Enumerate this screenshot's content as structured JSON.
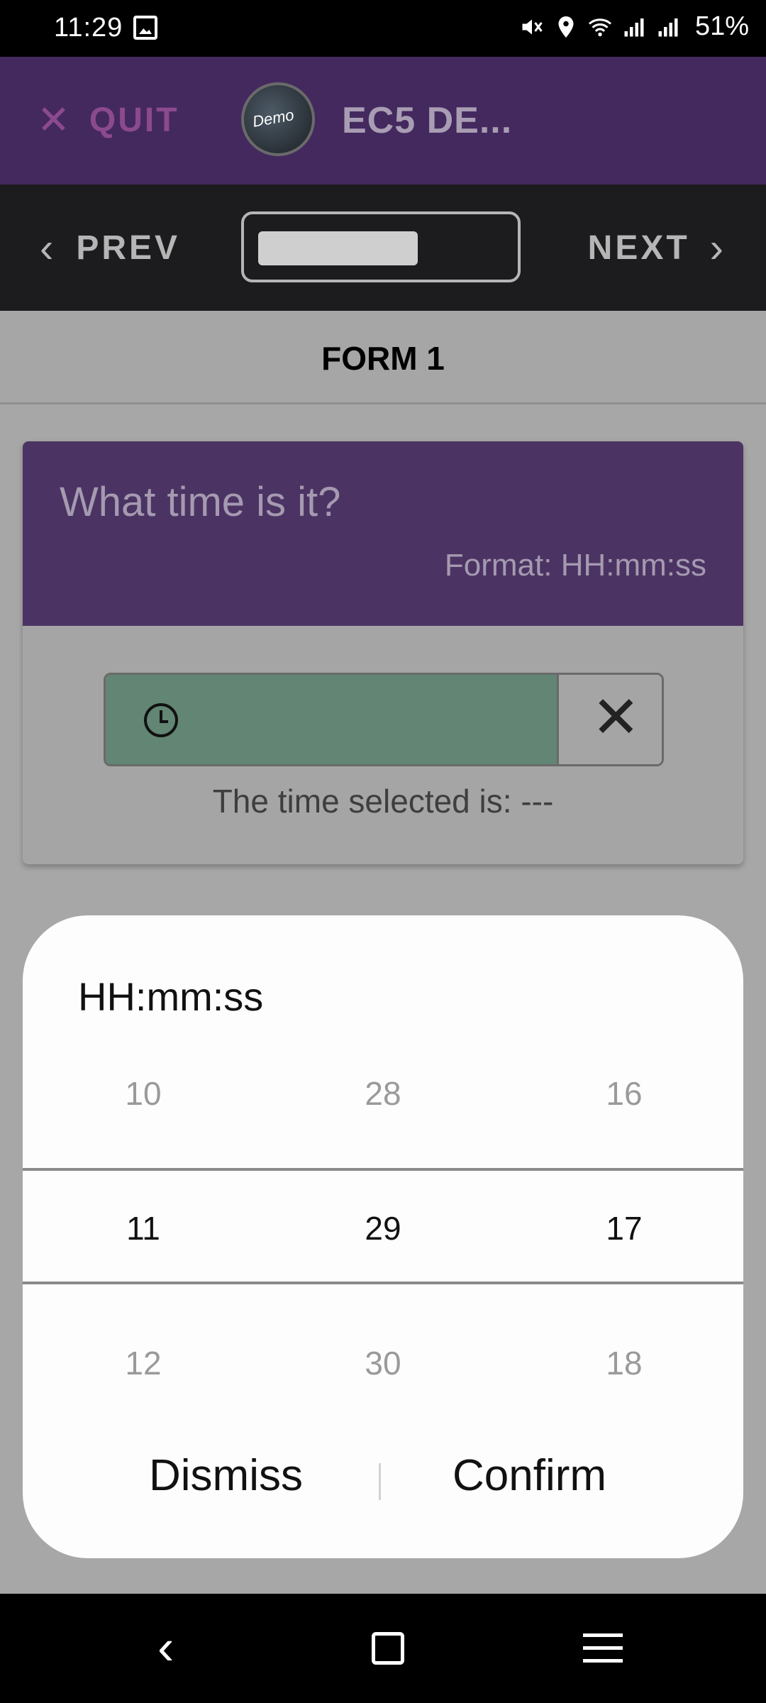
{
  "status_bar": {
    "time": "11:29",
    "battery": "51%",
    "icons": [
      "gallery-icon",
      "mute-icon",
      "location-icon",
      "wifi-icon",
      "signal-icon",
      "signal-r-icon"
    ]
  },
  "app_bar": {
    "quit_label": "QUIT",
    "quit_icon": "close-icon",
    "avatar_text": "Demo",
    "title": "EC5 DE..."
  },
  "nav": {
    "prev_label": "PREV",
    "next_label": "NEXT",
    "progress": 0.65
  },
  "form": {
    "title": "FORM 1"
  },
  "question": {
    "text": "What time is it?",
    "format": "Format: HH:mm:ss",
    "selected_text": "The time selected is: ---",
    "input_color": "#628574",
    "header_color": "#4b3463"
  },
  "picker": {
    "title": "HH:mm:ss",
    "columns": [
      {
        "above": "10",
        "selected": "11",
        "below": "12"
      },
      {
        "above": "28",
        "selected": "29",
        "below": "30"
      },
      {
        "above": "16",
        "selected": "17",
        "below": "18"
      }
    ],
    "dismiss_label": "Dismiss",
    "confirm_label": "Confirm"
  },
  "colors": {
    "app_bar": "#44295f",
    "nav_bar": "#1c1c1f",
    "quit": "#8c4a8e"
  }
}
